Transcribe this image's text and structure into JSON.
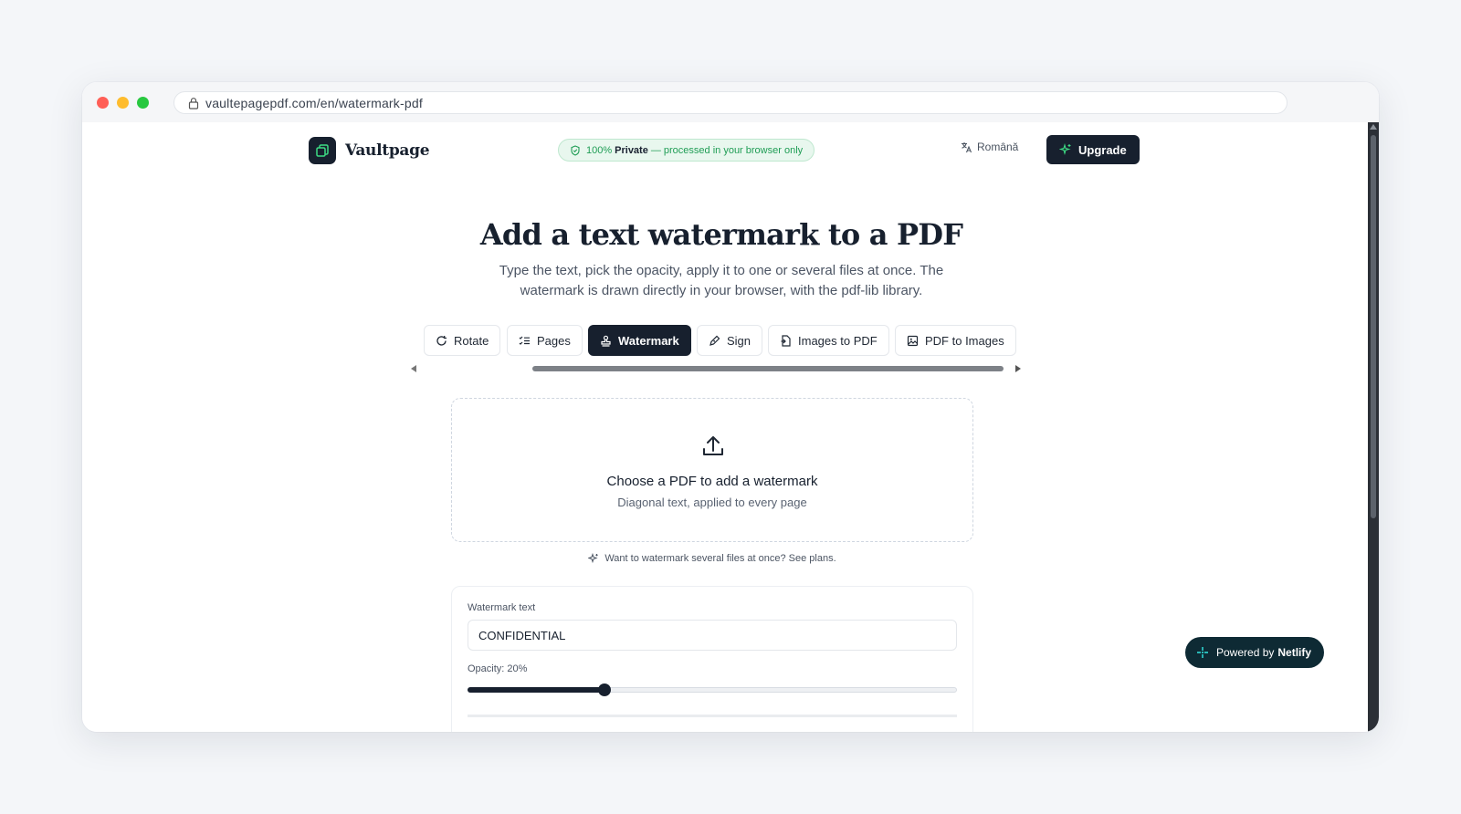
{
  "browser": {
    "url": "vaultepagepdf.com/en/watermark-pdf"
  },
  "header": {
    "brand": "Vaultpage",
    "privacy_percent": "100%",
    "privacy_strong": "Private",
    "privacy_rest": "— processed in your browser only",
    "language": "Română",
    "upgrade_label": "Upgrade"
  },
  "hero": {
    "title": "Add a text watermark to a PDF",
    "subtitle": "Type the text, pick the opacity, apply it to one or several files at once. The watermark is drawn directly in your browser, with the pdf-lib library."
  },
  "tabs": [
    {
      "label": "Rotate",
      "icon": "rotate-icon",
      "active": false
    },
    {
      "label": "Pages",
      "icon": "list-icon",
      "active": false
    },
    {
      "label": "Watermark",
      "icon": "stamp-icon",
      "active": true
    },
    {
      "label": "Sign",
      "icon": "pen-icon",
      "active": false
    },
    {
      "label": "Images to PDF",
      "icon": "file-image-icon",
      "active": false
    },
    {
      "label": "PDF to Images",
      "icon": "image-icon",
      "active": false
    }
  ],
  "dropzone": {
    "title": "Choose a PDF to add a watermark",
    "subtitle": "Diagonal text, applied to every page"
  },
  "plans_note": "Want to watermark several files at once? See plans.",
  "settings": {
    "text_label": "Watermark text",
    "text_value": "CONFIDENTIAL",
    "opacity_label": "Opacity: 20%",
    "opacity_fraction": 0.28
  },
  "badge": {
    "prefix": "Powered by",
    "brand": "Netlify"
  },
  "colors": {
    "brand_dark": "#17202e",
    "privacy_green": "#1f9d55",
    "netlify_bg": "#0e2a34"
  }
}
